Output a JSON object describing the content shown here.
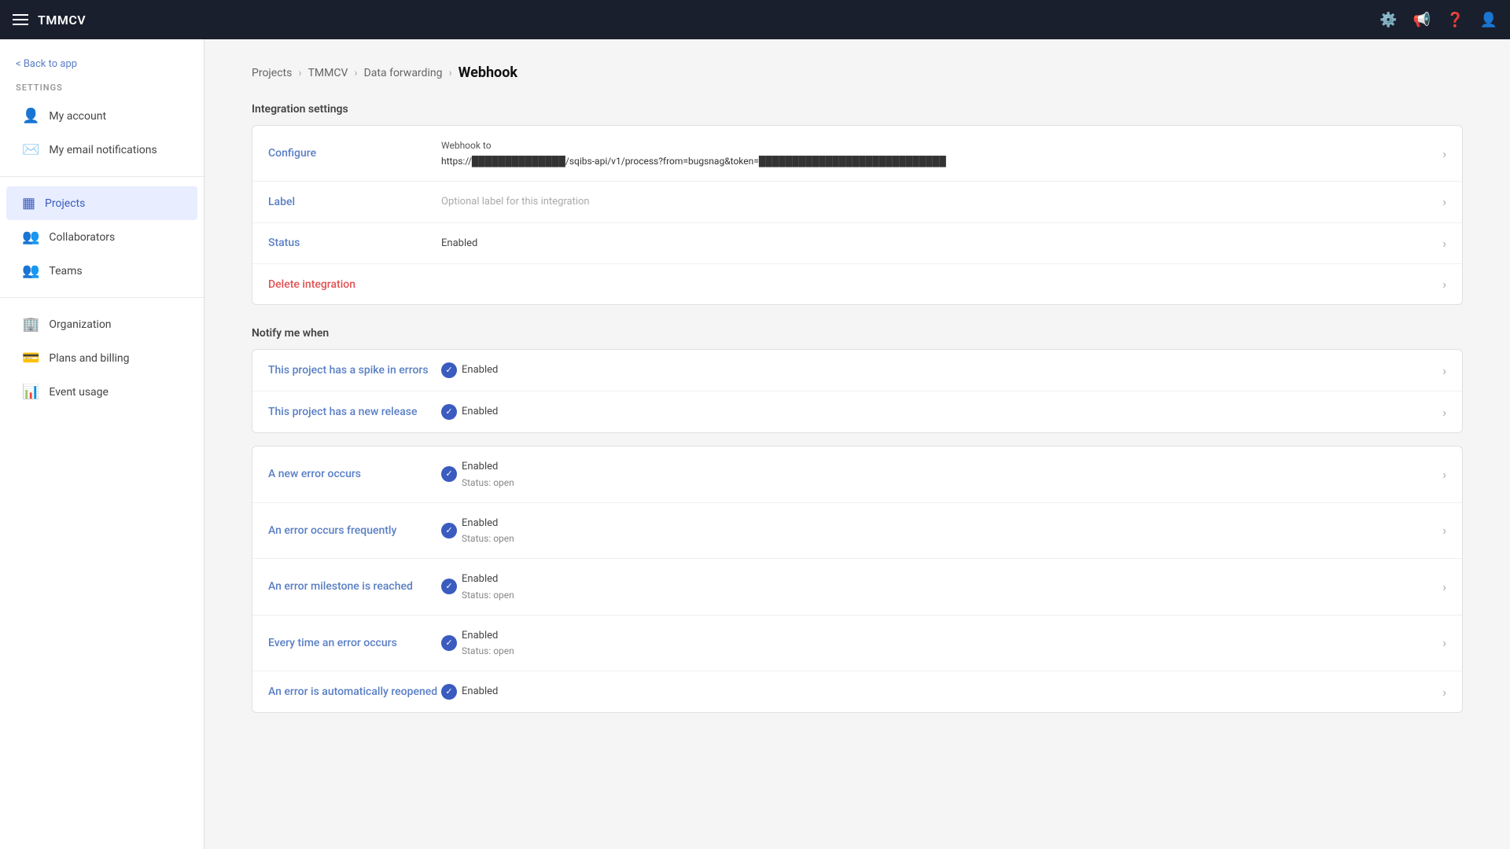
{
  "app": {
    "title": "TMMCV"
  },
  "topnav": {
    "icons": [
      "settings-icon",
      "announcement-icon",
      "help-icon",
      "user-icon"
    ]
  },
  "sidebar": {
    "back_label": "< Back to app",
    "settings_label": "SETTINGS",
    "items": [
      {
        "id": "my-account",
        "label": "My account",
        "icon": "👤",
        "active": false
      },
      {
        "id": "my-email-notifications",
        "label": "My email notifications",
        "icon": "✉️",
        "active": false
      },
      {
        "id": "projects",
        "label": "Projects",
        "icon": "📋",
        "active": true
      },
      {
        "id": "collaborators",
        "label": "Collaborators",
        "icon": "👥",
        "active": false
      },
      {
        "id": "teams",
        "label": "Teams",
        "icon": "👥",
        "active": false
      },
      {
        "id": "organization",
        "label": "Organization",
        "icon": "🏢",
        "active": false
      },
      {
        "id": "plans-and-billing",
        "label": "Plans and billing",
        "icon": "💳",
        "active": false
      },
      {
        "id": "event-usage",
        "label": "Event usage",
        "icon": "📊",
        "active": false
      }
    ]
  },
  "breadcrumb": {
    "items": [
      {
        "label": "Projects",
        "link": true
      },
      {
        "label": "TMMCV",
        "link": true
      },
      {
        "label": "Data forwarding",
        "link": true
      },
      {
        "label": "Webhook",
        "current": true
      }
    ]
  },
  "integration_settings": {
    "title": "Integration settings",
    "rows": [
      {
        "id": "configure",
        "label": "Configure",
        "value_type": "url",
        "value_prefix": "Webhook to",
        "value_url": "https://██████████████/sqibs-api/v1/process?from=bugsnag&token=████████████████████████████████████"
      },
      {
        "id": "label",
        "label": "Label",
        "value_type": "placeholder",
        "value": "Optional label for this integration"
      },
      {
        "id": "status",
        "label": "Status",
        "value_type": "text",
        "value": "Enabled"
      },
      {
        "id": "delete-integration",
        "label": "Delete integration",
        "value_type": "none",
        "delete": true
      }
    ]
  },
  "notify_section": {
    "title": "Notify me when",
    "groups": [
      {
        "rows": [
          {
            "id": "spike-in-errors",
            "label": "This project has a spike in errors",
            "status": "Enabled",
            "sub": null
          },
          {
            "id": "new-release",
            "label": "This project has a new release",
            "status": "Enabled",
            "sub": null
          }
        ]
      },
      {
        "rows": [
          {
            "id": "new-error-occurs",
            "label": "A new error occurs",
            "status": "Enabled",
            "sub": "Status: open"
          },
          {
            "id": "error-occurs-frequently",
            "label": "An error occurs frequently",
            "status": "Enabled",
            "sub": "Status: open"
          },
          {
            "id": "error-milestone-reached",
            "label": "An error milestone is reached",
            "status": "Enabled",
            "sub": "Status: open"
          },
          {
            "id": "every-time-error",
            "label": "Every time an error occurs",
            "status": "Enabled",
            "sub": "Status: open"
          },
          {
            "id": "error-reopened",
            "label": "An error is automatically reopened",
            "status": "Enabled",
            "sub": null
          }
        ]
      }
    ]
  }
}
